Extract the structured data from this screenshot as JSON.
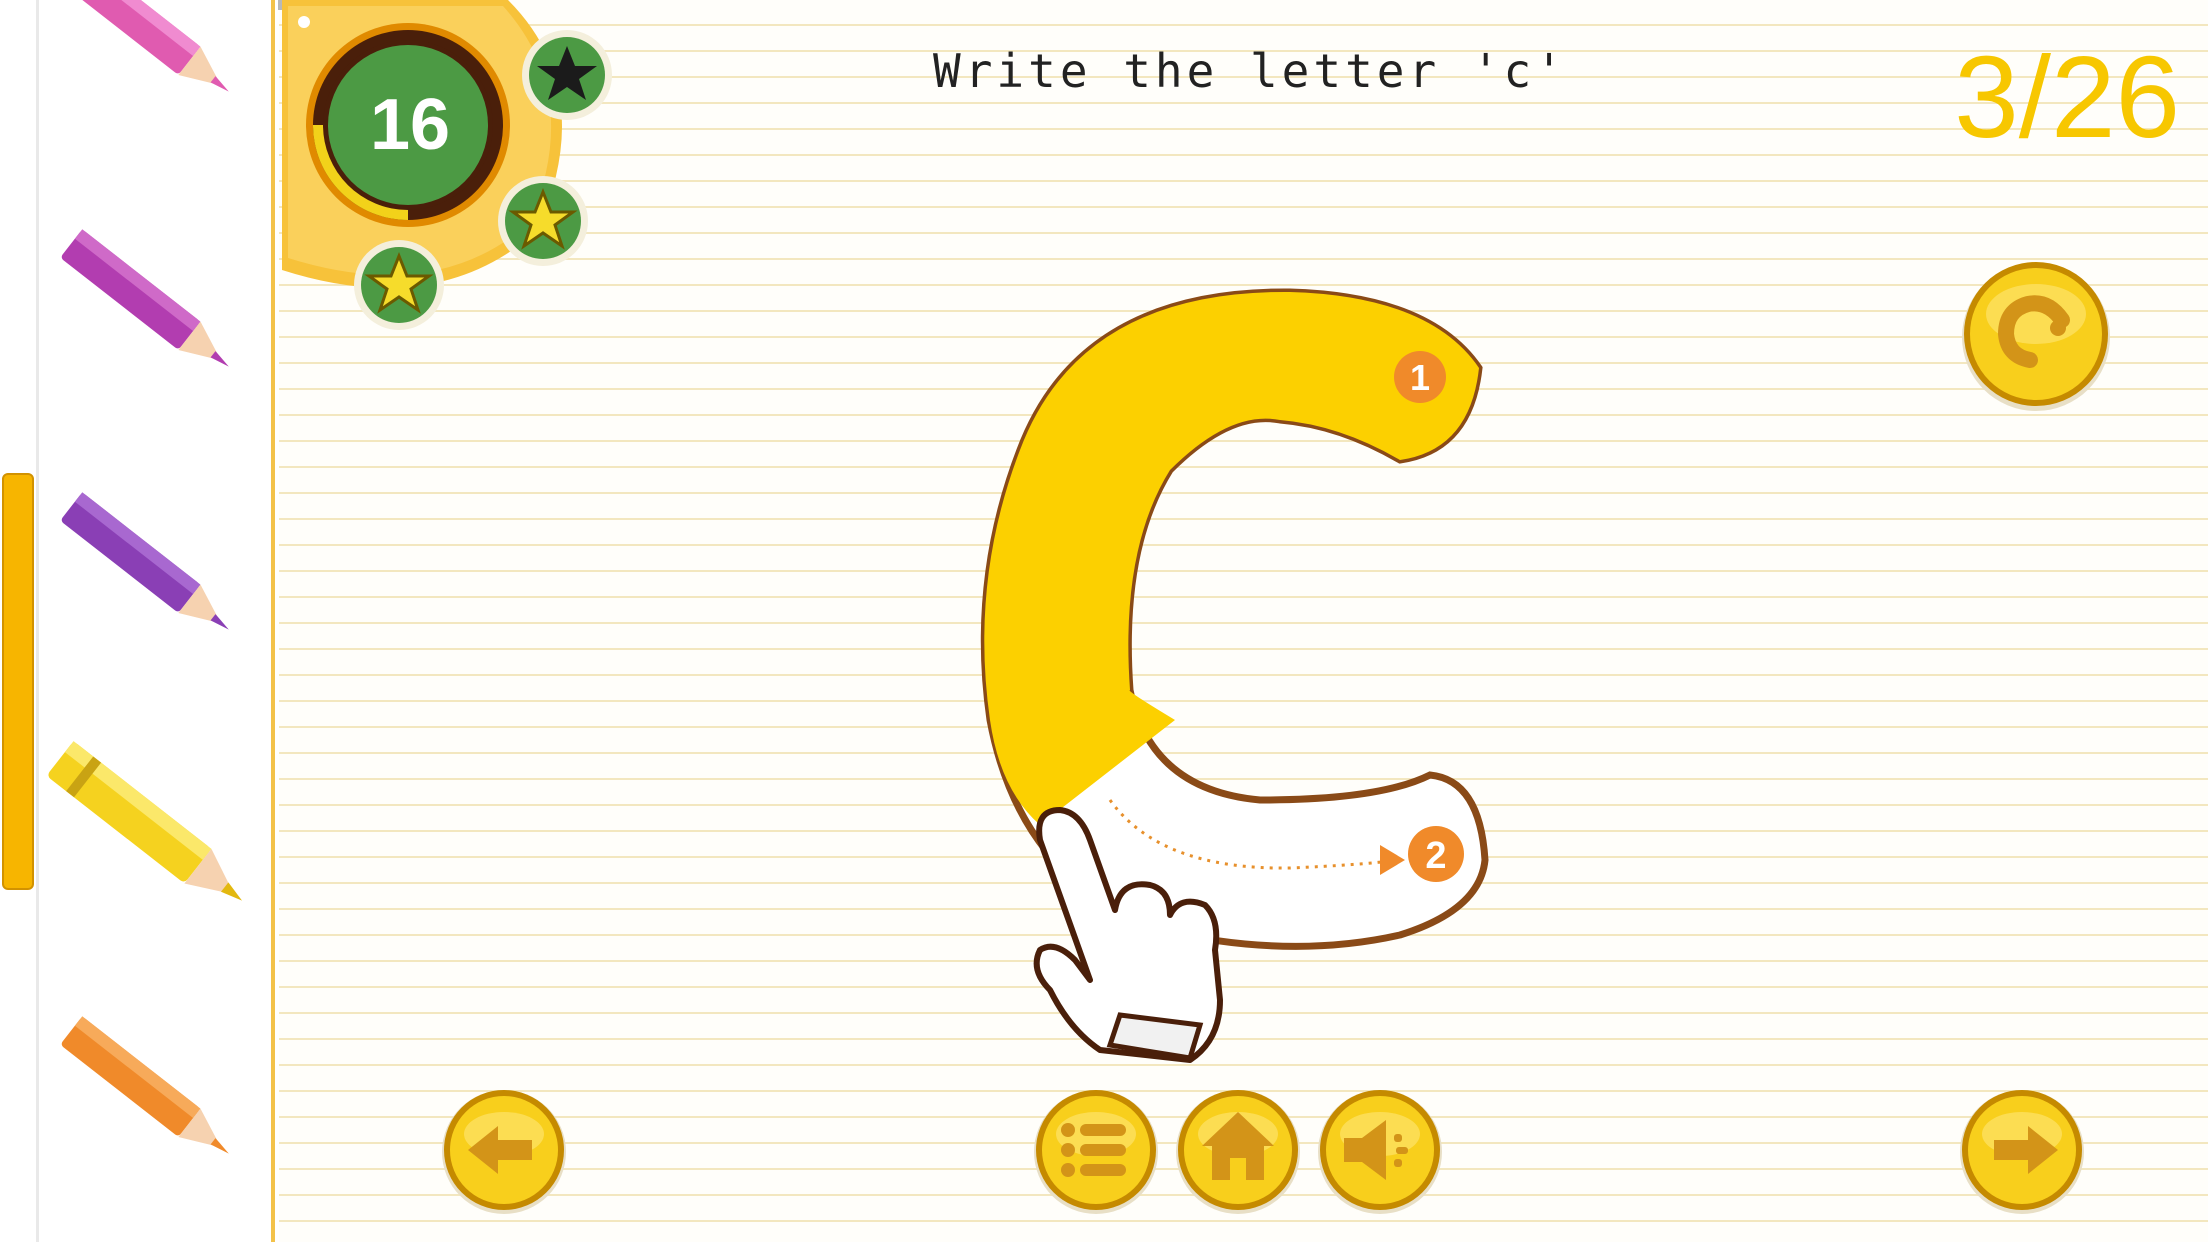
{
  "prompt": {
    "text": "Write the letter 'c'"
  },
  "progress": {
    "text": "3/26",
    "current": 3,
    "total": 26
  },
  "timer": {
    "value": "16",
    "ring_fill_fraction": 0.25
  },
  "stars": [
    {
      "icon": "star-icon",
      "state": "empty"
    },
    {
      "icon": "star-icon",
      "state": "earned"
    },
    {
      "icon": "star-icon",
      "state": "earned"
    }
  ],
  "pencils": [
    {
      "color": "#e05bb0",
      "name": "pink"
    },
    {
      "color": "#b23db0",
      "name": "magenta"
    },
    {
      "color": "#8a3fb5",
      "name": "purple"
    },
    {
      "color": "#f5d21f",
      "name": "yellow",
      "selected": true
    },
    {
      "color": "#f08a2a",
      "name": "orange"
    }
  ],
  "letter": {
    "char": "c",
    "fill_color": "#fcd000",
    "outline_color": "#8a4a17",
    "strokes": [
      "1",
      "2"
    ]
  },
  "buttons": {
    "previous": "back-arrow-icon",
    "menu": "list-icon",
    "home": "home-icon",
    "sound": "speaker-icon",
    "next": "forward-arrow-icon",
    "replay": "replay-letter-icon"
  },
  "colors": {
    "accent": "#f7c700",
    "button_gold": "#f8cf1c",
    "timer_green": "#4c9a44"
  }
}
